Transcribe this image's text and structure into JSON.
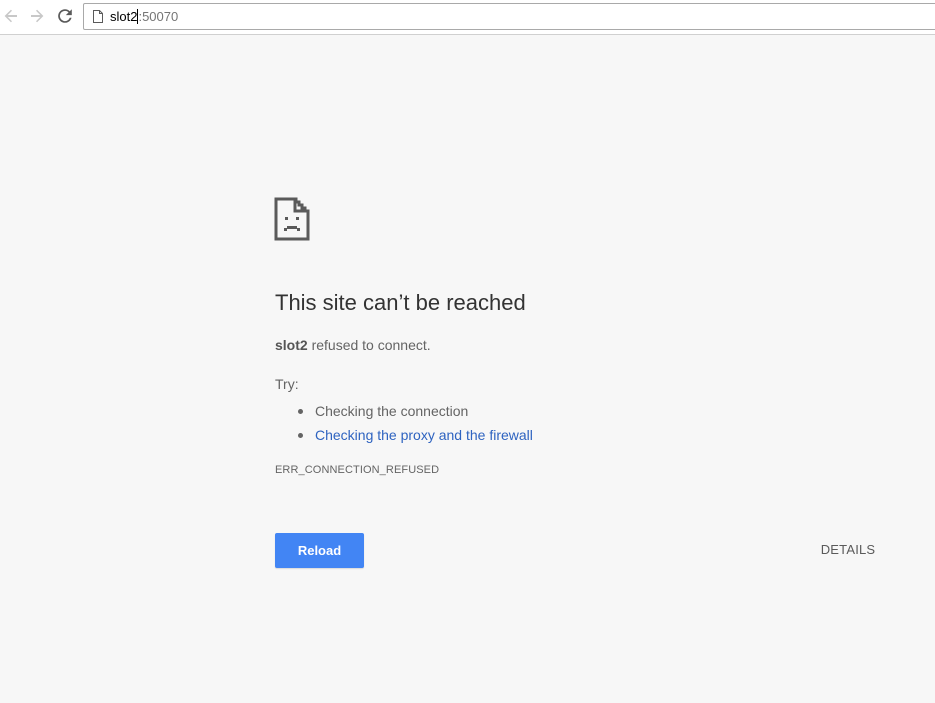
{
  "toolbar": {
    "back_icon": "arrow-left-icon",
    "forward_icon": "arrow-right-icon",
    "reload_icon": "refresh-icon",
    "page_icon": "document-icon",
    "url_host": "slot2",
    "url_rest": ":50070"
  },
  "error": {
    "icon": "sad-document-icon",
    "title": "This site can’t be reached",
    "host": "slot2",
    "summary_rest": " refused to connect.",
    "try_label": "Try:",
    "suggestions": [
      {
        "text": "Checking the connection",
        "is_link": false
      },
      {
        "text": "Checking the proxy and the firewall",
        "is_link": true
      }
    ],
    "code": "ERR_CONNECTION_REFUSED",
    "reload_label": "Reload",
    "details_label": "DETAILS"
  },
  "colors": {
    "page_background": "#f7f7f7",
    "button_blue": "#4285f4",
    "link_blue": "#2e63c0",
    "title_text": "#333333",
    "body_text": "#646464"
  }
}
